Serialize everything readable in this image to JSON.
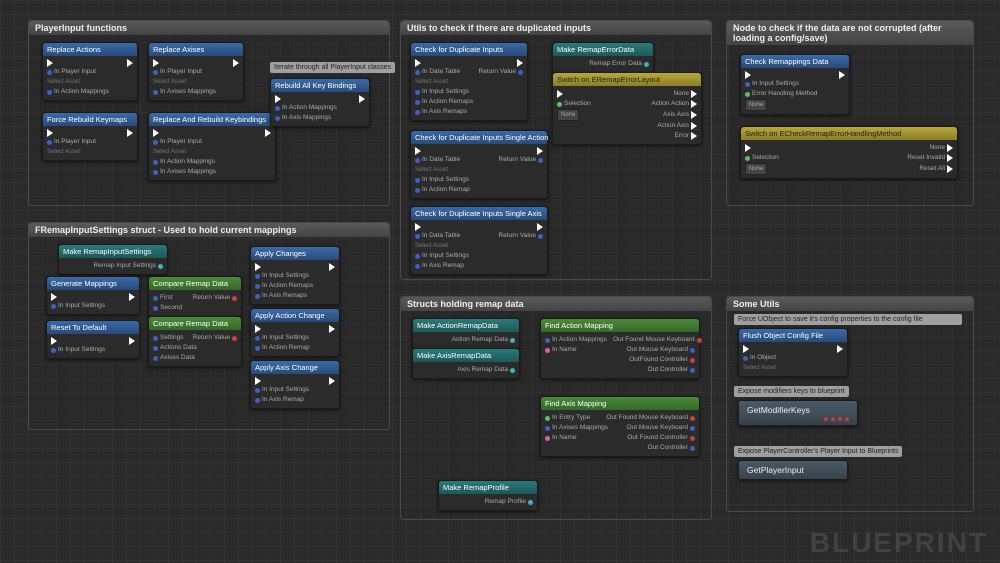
{
  "watermark": "BLUEPRINT",
  "groups": {
    "g1": {
      "title": "PlayerInput functions",
      "comment": "Iterate through all PlayerInput classes"
    },
    "g2": {
      "title": "FRemapInputSettings struct - Used to hold current mappings"
    },
    "g3": {
      "title": "Utils to check if there are duplicated inputs"
    },
    "g4": {
      "title": "Node to check if the data are not corrupted (after loading a config/save)"
    },
    "g5": {
      "title": "Structs holding remap data"
    },
    "g6": {
      "title": "Some Utils"
    }
  },
  "nodes": {
    "replaceActions": {
      "title": "Replace Actions",
      "pins": [
        "In Player Input",
        "In Action Mappings"
      ]
    },
    "replaceAxises": {
      "title": "Replace Axises",
      "pins": [
        "In Player Input",
        "In Axises Mappings"
      ]
    },
    "forceRebuild": {
      "title": "Force Rebuild Keymaps",
      "pins": [
        "In Player Input"
      ]
    },
    "replaceRebuild": {
      "title": "Replace And Rebuild Keybindings",
      "pins": [
        "In Player Input",
        "In Action Mappings",
        "In Axises Mappings"
      ]
    },
    "rebuildAll": {
      "title": "Rebuild All Key Bindings",
      "pins": [
        "In Action Mappings",
        "In Axis Mappings"
      ]
    },
    "makeSettings": {
      "title": "Make RemapInputSettings",
      "out": "Remap Input Settings"
    },
    "genMappings": {
      "title": "Generate Mappings",
      "pins": [
        "In Input Settings"
      ]
    },
    "resetDefault": {
      "title": "Reset To Default",
      "pins": [
        "In Input Settings"
      ]
    },
    "compare1": {
      "title": "Compare Remap Data",
      "left": [
        "First",
        "Second"
      ],
      "out": "Return Value"
    },
    "compare2": {
      "title": "Compare Remap Data",
      "left": [
        "Settings",
        "Actions Data",
        "Axises Data"
      ],
      "out": "Return Value"
    },
    "applyChanges": {
      "title": "Apply Changes",
      "pins": [
        "In Input Settings",
        "In Action Remaps",
        "In Axis Remaps"
      ]
    },
    "applyAction": {
      "title": "Apply Action Change",
      "pins": [
        "In Input Settings",
        "In Action Remap"
      ]
    },
    "applyAxis": {
      "title": "Apply Axis Change",
      "pins": [
        "In Input Settings",
        "In Axis Remap"
      ]
    },
    "checkDup": {
      "title": "Check for Duplicate Inputs",
      "left": [
        "In Data Table",
        "In Input Settings",
        "In Action Remaps",
        "In Axis Remaps"
      ],
      "out": "Return Value"
    },
    "checkDupAction": {
      "title": "Check for Duplicate Inputs Single Action",
      "left": [
        "In Data Table",
        "In Input Settings",
        "In Action Remap"
      ],
      "out": "Return Value"
    },
    "checkDupAxis": {
      "title": "Check for Duplicate Inputs Single Axis",
      "left": [
        "In Data Table",
        "In Input Settings",
        "In Axis Remap"
      ],
      "out": "Return Value"
    },
    "makeError": {
      "title": "Make RemapErrorData",
      "out": "Remap Error Data"
    },
    "switchLayout": {
      "title": "Switch on ERemapErrorLayout",
      "sel": "Selection",
      "outs": [
        "None",
        "Action Action",
        "Axis Axis",
        "Action Axis",
        "Error"
      ]
    },
    "checkRemap": {
      "title": "Check Remappings Data",
      "pins": [
        "In Input Settings",
        "Error Handling Method"
      ]
    },
    "switchMethod": {
      "title": "Switch on ECheckRemapErrorHandlingMethod",
      "sel": "Selection",
      "outs": [
        "None",
        "Reset Invalid",
        "Reset All"
      ]
    },
    "makeActionRemap": {
      "title": "Make ActionRemapData",
      "out": "Action Remap Data"
    },
    "makeAxisRemap": {
      "title": "Make AxisRemapData",
      "out": "Axis Remap Data"
    },
    "findAction": {
      "title": "Find Action Mapping",
      "left": [
        "In Action Mappings",
        "In Name"
      ],
      "outs": [
        "Out Found Mouse Keyboard",
        "Out Mouse Keyboard",
        "OutFound Controller",
        "Out Controller"
      ]
    },
    "findAxis": {
      "title": "Find Axis Mapping",
      "left": [
        "In Entry Type",
        "In Axises Mappings",
        "In Name"
      ],
      "outs": [
        "Out Found Mouse Keyboard",
        "Out Mouse Keyboard",
        "Out Found Controller",
        "Out Controller"
      ]
    },
    "makeProfile": {
      "title": "Make RemapProfile",
      "out": "Remap Profile"
    },
    "flushConfig": {
      "title": "Flush Object Config File",
      "pins": [
        "In Object"
      ]
    },
    "getModKeys": {
      "title": "GetModifierKeys"
    },
    "getPlayerInput": {
      "title": "GetPlayerInput"
    }
  },
  "comments": {
    "c1": "Force UObject to save it's config properties to the config file",
    "c2": "Expose modifiers keys to blueprint",
    "c3": "Expose PlayerController's Player Input to Blueprints"
  },
  "labels": {
    "selectAsset": "Select Asset",
    "none": "None"
  }
}
